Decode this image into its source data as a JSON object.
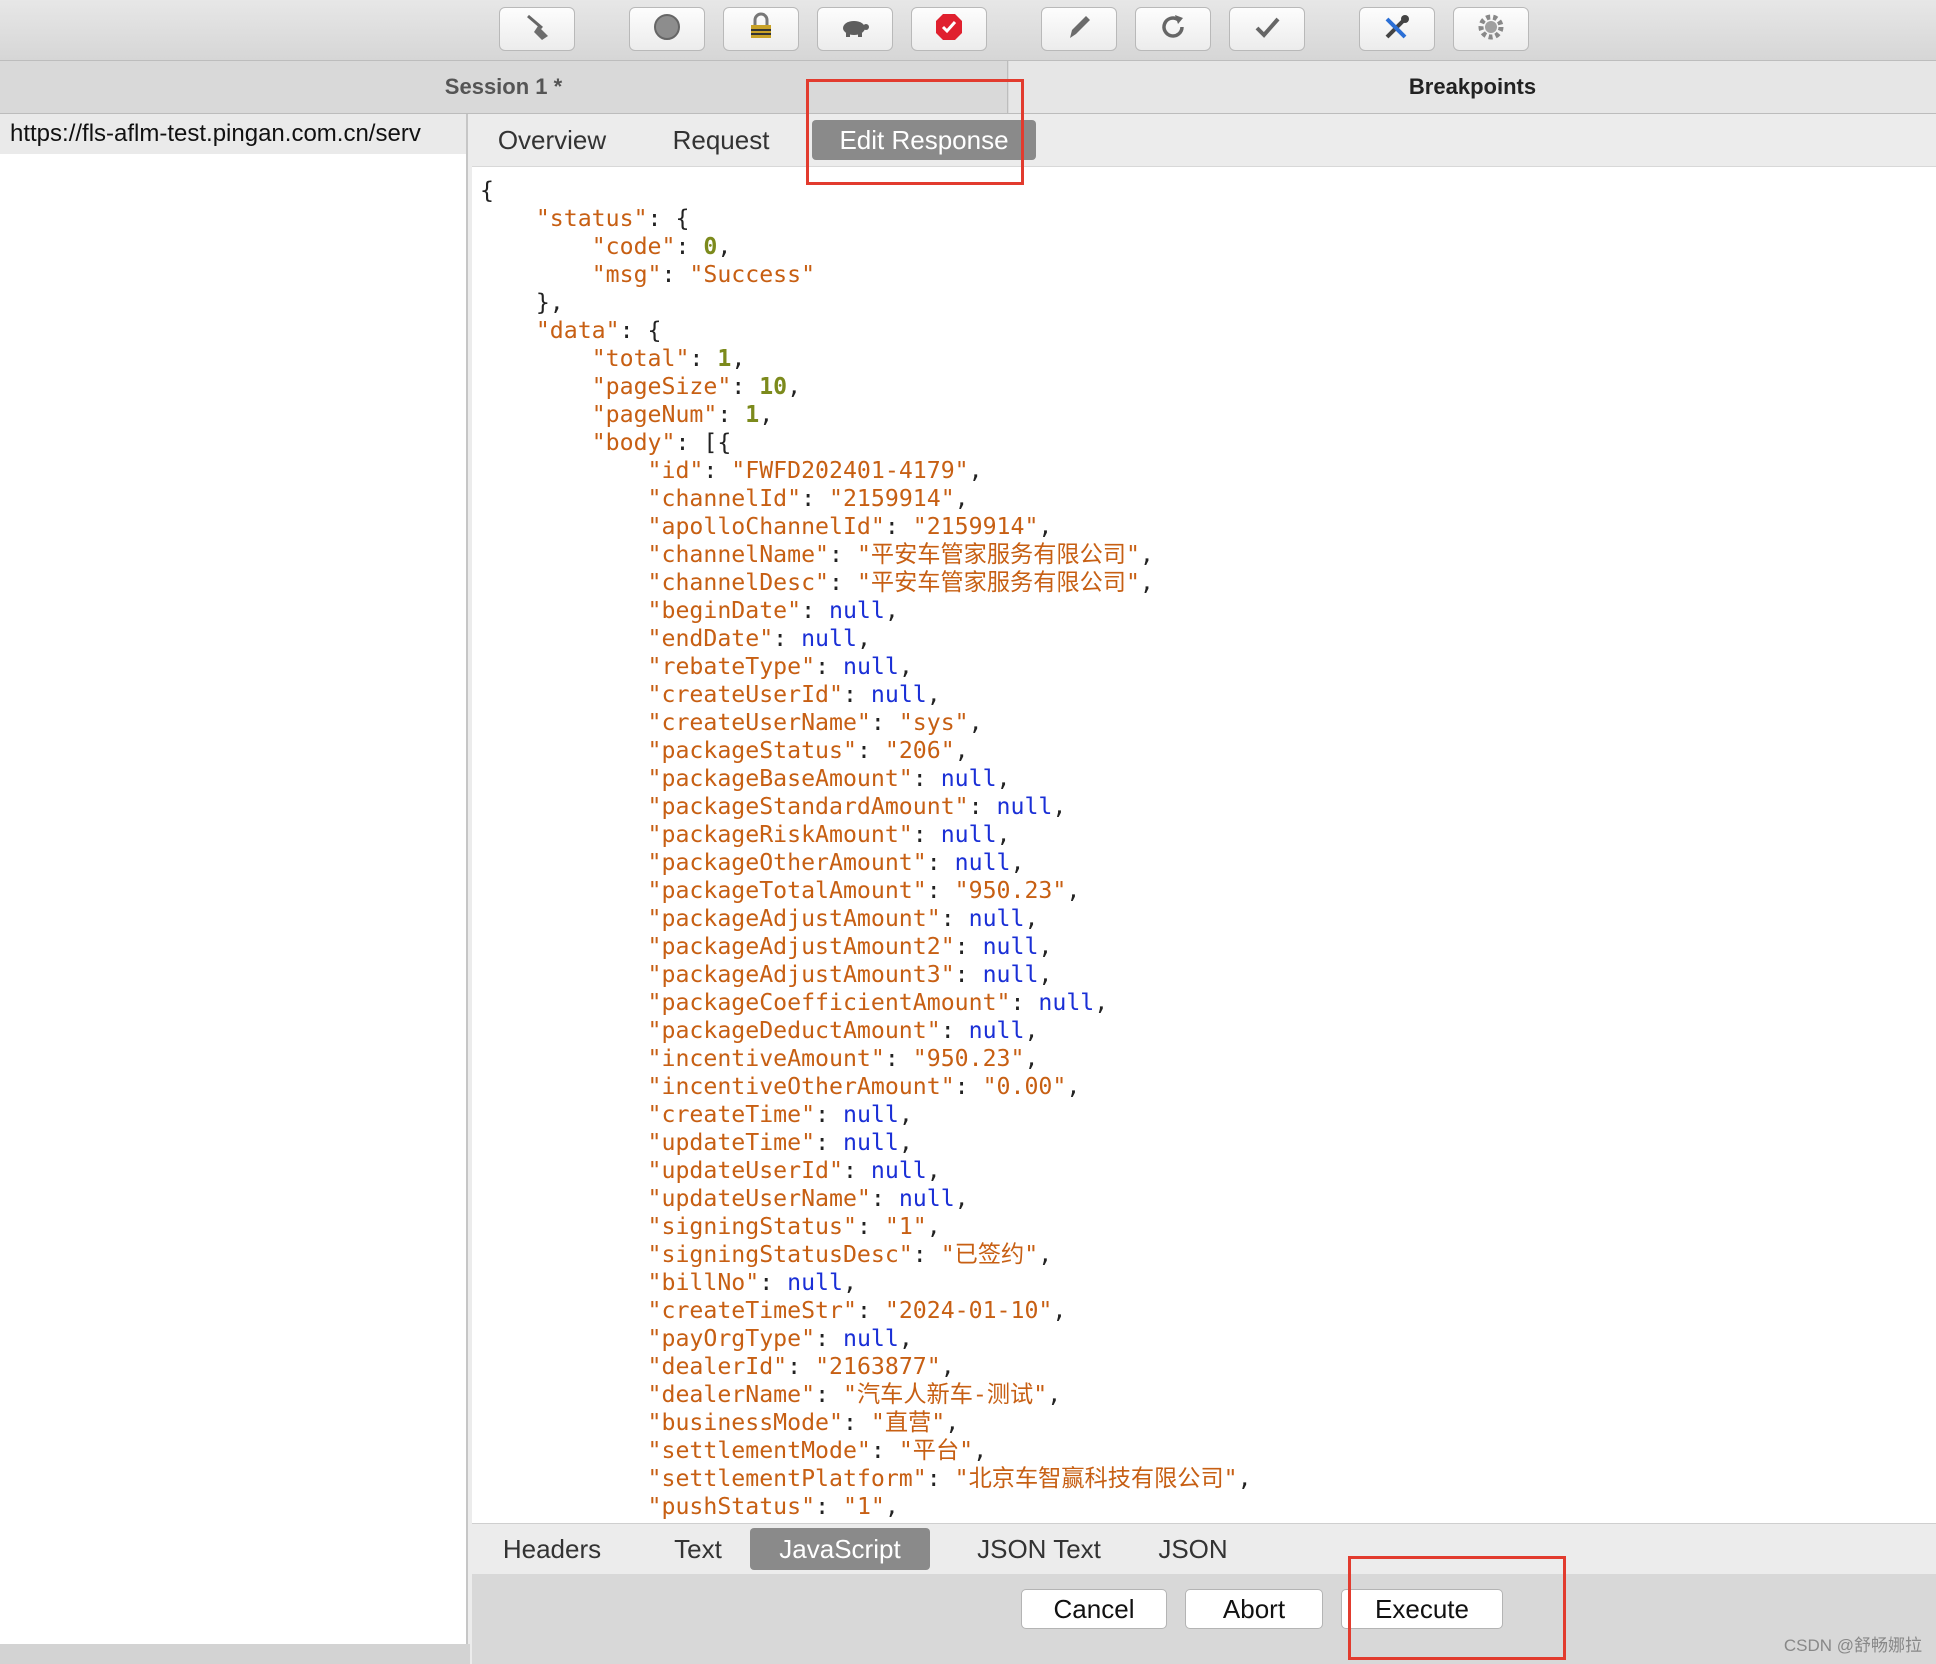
{
  "toolbar": {
    "buttons": [
      {
        "icon": "broom-icon"
      },
      {
        "icon": "record-icon"
      },
      {
        "icon": "ssl-lock-icon"
      },
      {
        "icon": "turtle-throttle-icon"
      },
      {
        "icon": "breakpoint-icon"
      },
      {
        "icon": "pen-compose-icon"
      },
      {
        "icon": "refresh-icon"
      },
      {
        "icon": "checkmark-icon"
      },
      {
        "icon": "tools-icon"
      },
      {
        "icon": "settings-gear-icon"
      }
    ]
  },
  "session_tab": "Session 1 *",
  "breakpoints_tab": "Breakpoints",
  "left_url": "https://fls-aflm-test.pingan.com.cn/serv",
  "top_tabs": [
    "Overview",
    "Request",
    "Edit Response"
  ],
  "top_tab_active": "Edit Response",
  "bottom_tabs": [
    "Headers",
    "Text",
    "JavaScript",
    "JSON Text",
    "JSON"
  ],
  "bottom_tab_active": "JavaScript",
  "actions": {
    "cancel": "Cancel",
    "abort": "Abort",
    "execute": "Execute"
  },
  "code": {
    "status": [
      [
        "code",
        0
      ],
      [
        "msg",
        "Success"
      ]
    ],
    "data_meta": [
      [
        "total",
        1
      ],
      [
        "pageSize",
        10
      ],
      [
        "pageNum",
        1
      ]
    ],
    "body": [
      [
        "id",
        "FWFD202401-4179"
      ],
      [
        "channelId",
        "2159914"
      ],
      [
        "apolloChannelId",
        "2159914"
      ],
      [
        "channelName",
        "平安车管家服务有限公司"
      ],
      [
        "channelDesc",
        "平安车管家服务有限公司"
      ],
      [
        "beginDate",
        null
      ],
      [
        "endDate",
        null
      ],
      [
        "rebateType",
        null
      ],
      [
        "createUserId",
        null
      ],
      [
        "createUserName",
        "sys"
      ],
      [
        "packageStatus",
        "206"
      ],
      [
        "packageBaseAmount",
        null
      ],
      [
        "packageStandardAmount",
        null
      ],
      [
        "packageRiskAmount",
        null
      ],
      [
        "packageOtherAmount",
        null
      ],
      [
        "packageTotalAmount",
        "950.23"
      ],
      [
        "packageAdjustAmount",
        null
      ],
      [
        "packageAdjustAmount2",
        null
      ],
      [
        "packageAdjustAmount3",
        null
      ],
      [
        "packageCoefficientAmount",
        null
      ],
      [
        "packageDeductAmount",
        null
      ],
      [
        "incentiveAmount",
        "950.23"
      ],
      [
        "incentiveOtherAmount",
        "0.00"
      ],
      [
        "createTime",
        null
      ],
      [
        "updateTime",
        null
      ],
      [
        "updateUserId",
        null
      ],
      [
        "updateUserName",
        null
      ],
      [
        "signingStatus",
        "1"
      ],
      [
        "signingStatusDesc",
        "已签约"
      ],
      [
        "billNo",
        null
      ],
      [
        "createTimeStr",
        "2024-01-10"
      ],
      [
        "payOrgType",
        null
      ],
      [
        "dealerId",
        "2163877"
      ],
      [
        "dealerName",
        "汽车人新车-测试"
      ],
      [
        "businessMode",
        "直营"
      ],
      [
        "settlementMode",
        "平台"
      ],
      [
        "settlementPlatform",
        "北京车智赢科技有限公司"
      ],
      [
        "pushStatus",
        "1"
      ]
    ]
  },
  "watermark": "CSDN @舒畅娜拉",
  "colors": {
    "highlight": "#e23b2e",
    "active_tab": "#8a8a8a",
    "json_key": "#c75f13",
    "json_number": "#7c8a1c",
    "json_null": "#1a2fd6"
  }
}
